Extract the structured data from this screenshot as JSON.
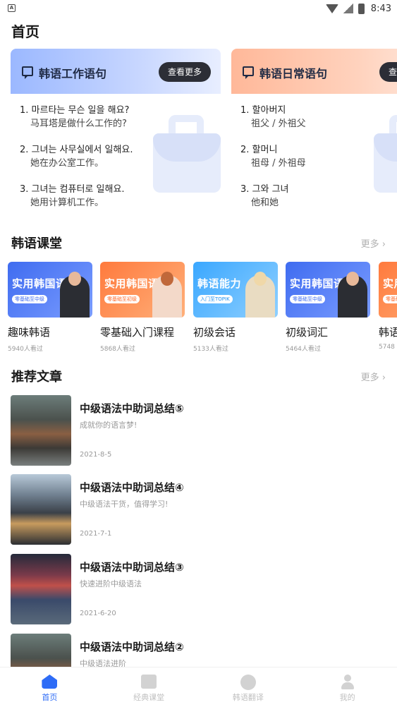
{
  "status_bar": {
    "app_icon_letter": "A",
    "time": "8:43"
  },
  "page_title": "首页",
  "phrase_cards": [
    {
      "title": "韩语工作语句",
      "button": "查看更多",
      "phrases": [
        {
          "ko": "1. 마르타는 무슨 일을 해요?",
          "zh": "马耳塔是做什么工作的?"
        },
        {
          "ko": "2. 그녀는 사무실에서 일해요.",
          "zh": "她在办公室工作。"
        },
        {
          "ko": "3. 그녀는 컴퓨터로 일해요.",
          "zh": "她用计算机工作。"
        }
      ]
    },
    {
      "title": "韩语日常语句",
      "button": "查看更多",
      "phrases": [
        {
          "ko": "1. 할아버지",
          "zh": "祖父 / 外祖父"
        },
        {
          "ko": "2. 할머니",
          "zh": "祖母 / 外祖母"
        },
        {
          "ko": "3. 그와 그녀",
          "zh": "他和她"
        }
      ]
    }
  ],
  "courses_section": {
    "title": "韩语课堂",
    "more": "更多 ›",
    "items": [
      {
        "thumb_text": "实用韩国语",
        "thumb_badge": "零基础至中级",
        "title": "趣味韩语",
        "views": "5940人看过"
      },
      {
        "thumb_text": "实用韩国语",
        "thumb_badge": "零基础至初级",
        "title": "零基础入门课程",
        "views": "5868人看过"
      },
      {
        "thumb_text": "韩语能力",
        "thumb_badge": "入门至TOPIK",
        "title": "初级会话",
        "views": "5133人看过"
      },
      {
        "thumb_text": "实用韩国语",
        "thumb_badge": "零基础至中级",
        "title": "初级词汇",
        "views": "5464人看过"
      },
      {
        "thumb_text": "实用",
        "thumb_badge": "零基础至中级",
        "title": "韩语",
        "views": "5748"
      }
    ]
  },
  "articles_section": {
    "title": "推荐文章",
    "more": "更多 ›",
    "items": [
      {
        "title": "中级语法中助词总结⑤",
        "subtitle": "成就你的语言梦!",
        "date": "2021-8-5"
      },
      {
        "title": "中级语法中助词总结④",
        "subtitle": "中级语法干货，值得学习!",
        "date": "2021-7-1"
      },
      {
        "title": "中级语法中助词总结③",
        "subtitle": "快速进阶中级语法",
        "date": "2021-6-20"
      },
      {
        "title": "中级语法中助词总结②",
        "subtitle": "中级语法进阶",
        "date": ""
      }
    ]
  },
  "bottom_nav": [
    {
      "label": "首页",
      "icon": "home-icon",
      "active": true
    },
    {
      "label": "经典课堂",
      "icon": "book-icon",
      "active": false
    },
    {
      "label": "韩语翻译",
      "icon": "translate-icon",
      "active": false
    },
    {
      "label": "我的",
      "icon": "user-icon",
      "active": false
    }
  ],
  "colors": {
    "accent": "#2e6cf6",
    "more_button_bg": "#2c2e36",
    "muted_text": "#9a9a9a"
  }
}
